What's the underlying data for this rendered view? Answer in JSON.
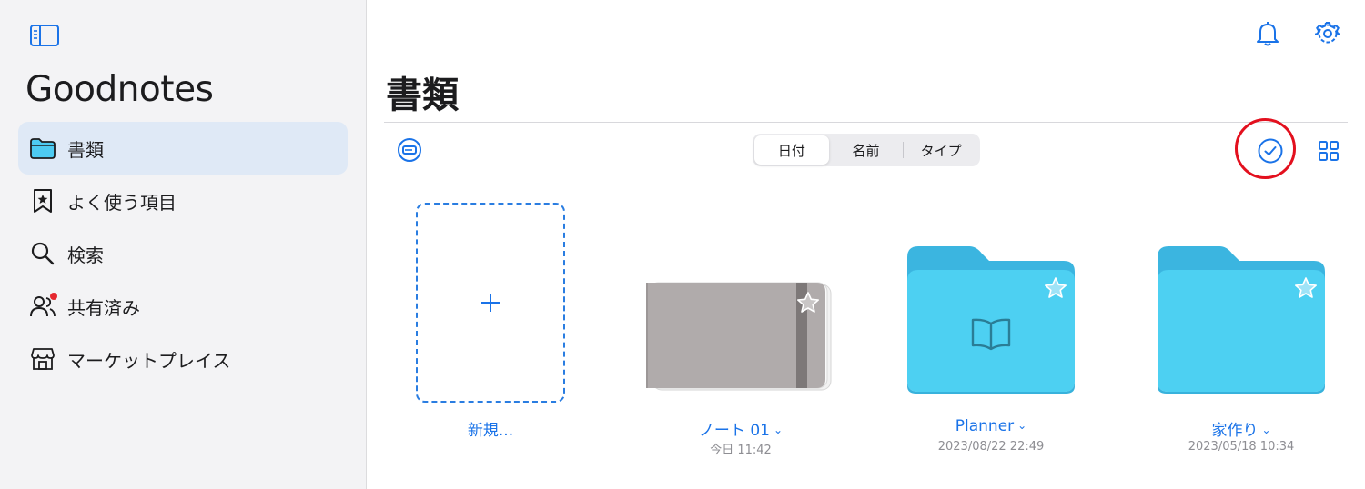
{
  "sidebar": {
    "app_title": "Goodnotes",
    "items": [
      {
        "label": "書類",
        "icon": "folder-icon",
        "active": true
      },
      {
        "label": "よく使う項目",
        "icon": "bookmark-star-icon",
        "active": false
      },
      {
        "label": "検索",
        "icon": "search-icon",
        "active": false
      },
      {
        "label": "共有済み",
        "icon": "people-icon",
        "active": false,
        "badge": "red-dot"
      },
      {
        "label": "マーケットプレイス",
        "icon": "store-icon",
        "active": false
      }
    ]
  },
  "main": {
    "title": "書類",
    "sort_tabs": [
      {
        "label": "日付",
        "active": true
      },
      {
        "label": "名前",
        "active": false
      },
      {
        "label": "タイプ",
        "active": false
      }
    ],
    "items": [
      {
        "type": "new",
        "label": "新規..."
      },
      {
        "type": "notebook",
        "label": "ノート 01",
        "date": "今日 11:42"
      },
      {
        "type": "folder",
        "label": "Planner",
        "date": "2023/08/22 22:49"
      },
      {
        "type": "folder",
        "label": "家作り",
        "date": "2023/05/18 10:34"
      }
    ]
  },
  "colors": {
    "accent": "#1a73e8",
    "sidebar_bg": "#f3f3f5",
    "active_item_bg": "#dfe9f6",
    "folder_blue": "#4dcbf2",
    "notebook_gray": "#b0abab",
    "highlight_red": "#e3101e"
  }
}
